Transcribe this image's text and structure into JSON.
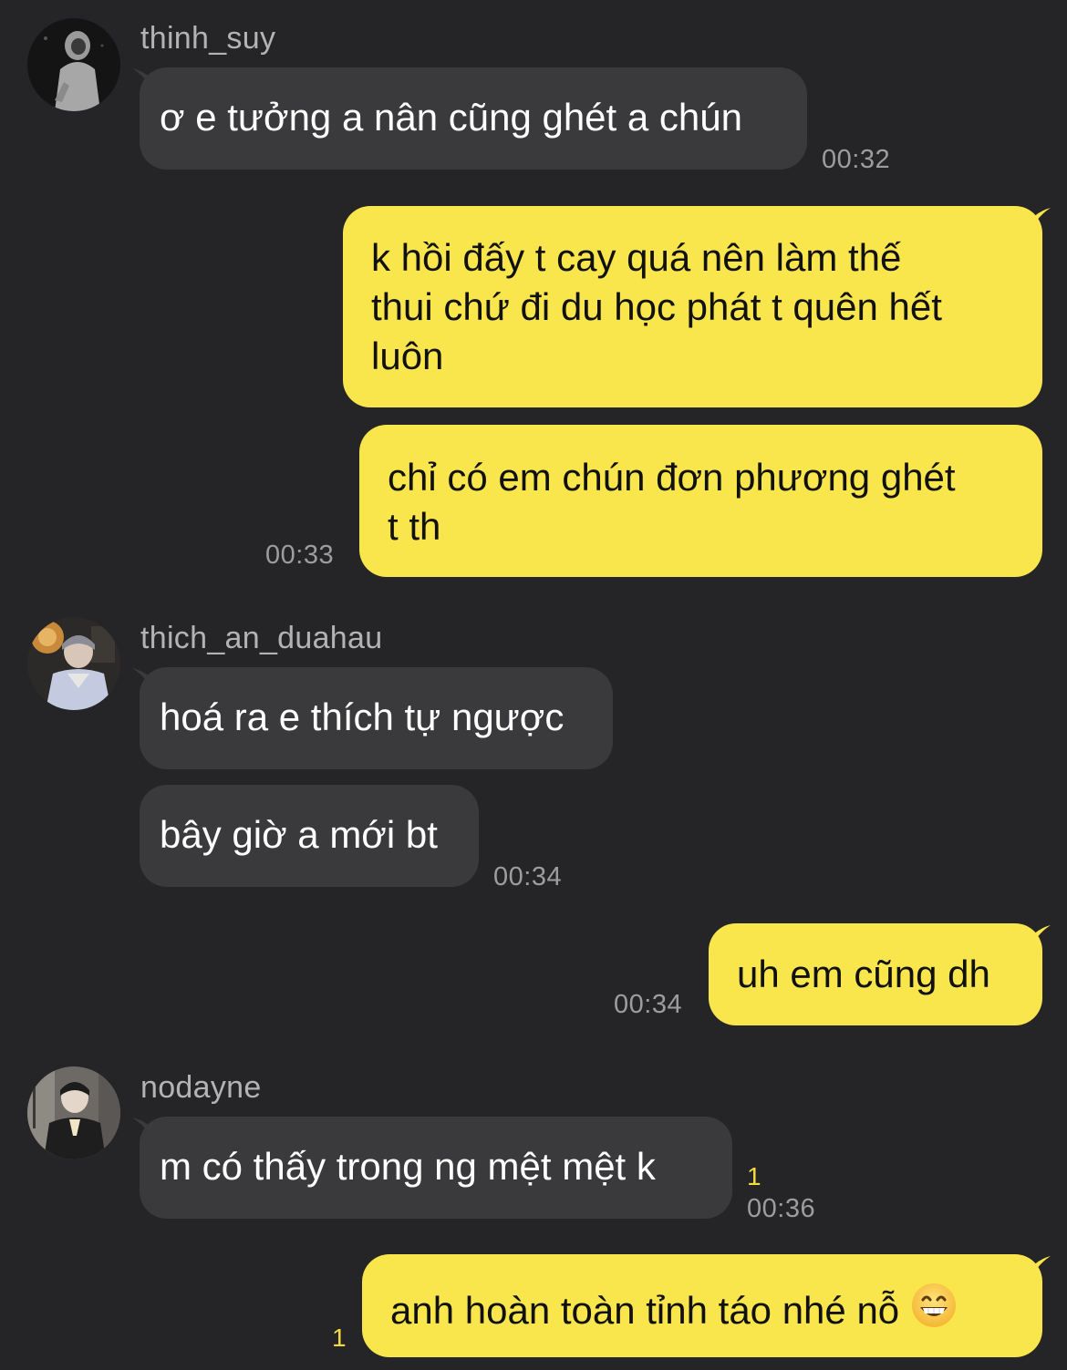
{
  "colors": {
    "background": "#252527",
    "incoming_bubble": "#3a3a3c",
    "outgoing_bubble": "#f9e54c",
    "timestamp": "#9d9da0",
    "unread_count": "#f3da3f",
    "username": "#b3b3b5"
  },
  "messages": {
    "m1": {
      "sender": "thinh_suy",
      "text": "ơ e tưởng a nân cũng ghét a chún",
      "time": "00:32"
    },
    "m2": {
      "lines": [
        "k hồi đấy t cay quá nên làm thế",
        "thui chứ đi du học phát t quên hết",
        "luôn"
      ]
    },
    "m3": {
      "lines": [
        "chỉ có em chún đơn phương ghét",
        "t th"
      ],
      "time": "00:33"
    },
    "m4": {
      "sender": "thich_an_duahau",
      "text": "hoá ra e thích tự ngược"
    },
    "m5": {
      "text": "bây giờ a mới bt",
      "time": "00:34"
    },
    "m6": {
      "text": "uh em cũng dh",
      "time": "00:34"
    },
    "m7": {
      "sender": "nodayne",
      "text": "m có thấy trong ng mệt mệt k",
      "unread": "1",
      "time": "00:36"
    },
    "m8": {
      "text": "anh hoàn toàn tỉnh táo nhé nỗ",
      "emoji": "grinning-face-emoji",
      "unread": "1"
    }
  }
}
